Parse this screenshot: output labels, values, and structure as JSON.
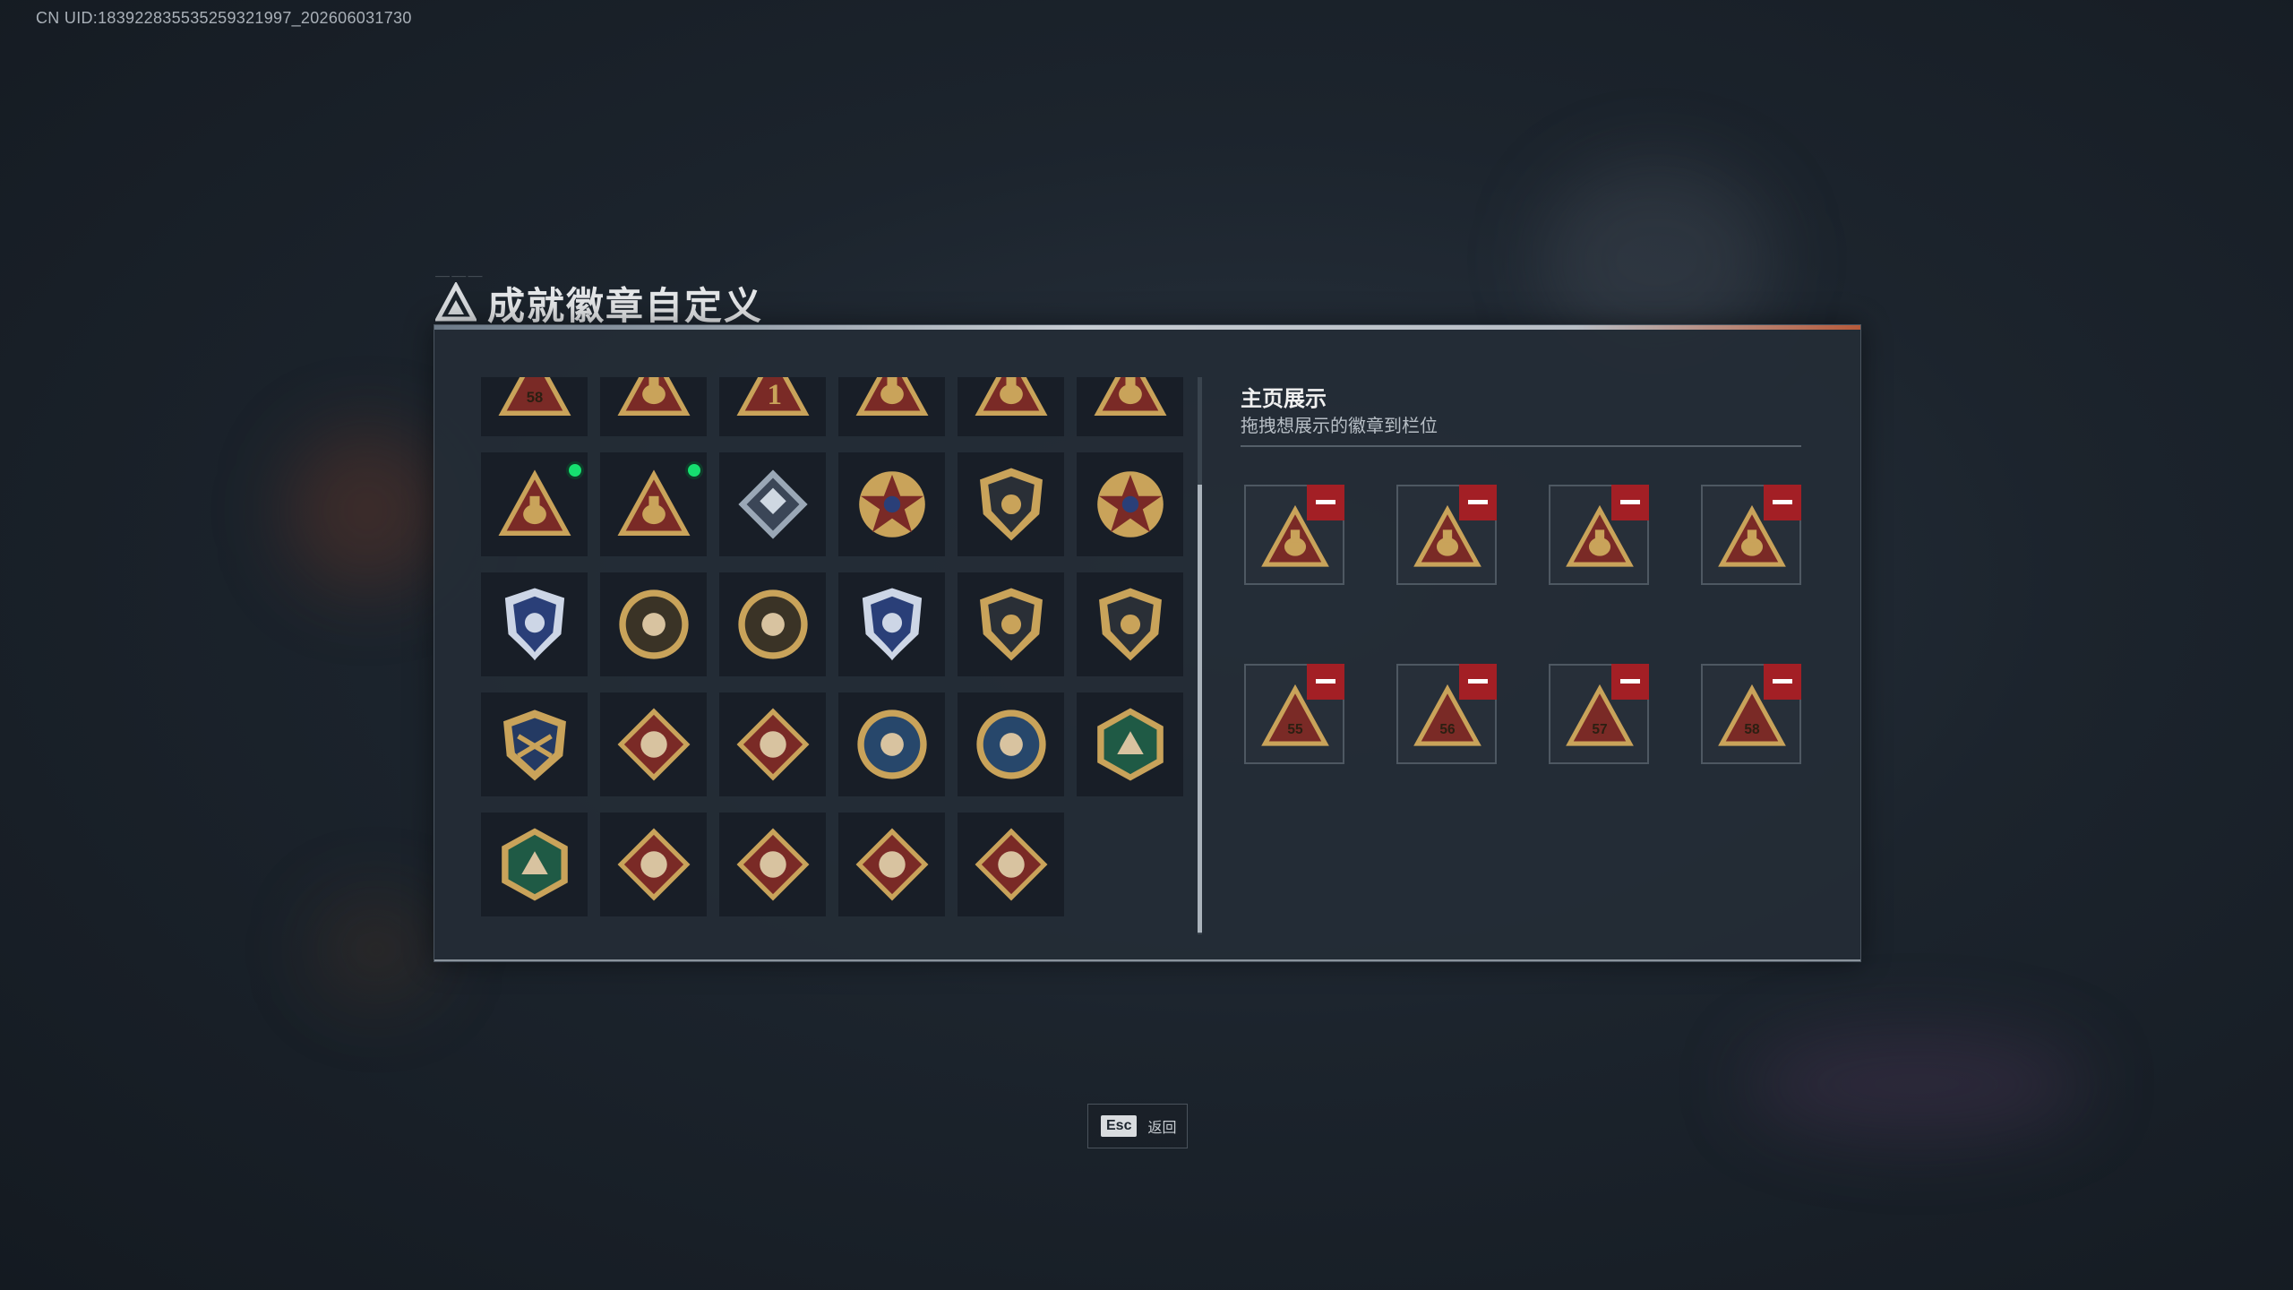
{
  "uid_text": "CN UID:183922835535259321997_202606031730",
  "title": "成就徽章自定义",
  "colors": {
    "accent_gold": "#c9a35a",
    "badge_red": "#7a2a26",
    "badge_dark": "#2a2f36",
    "new_indicator": "#16e070",
    "remove_red": "#a31f25"
  },
  "badge_grid": [
    [
      {
        "icon": "triangle-badge-58-icon"
      },
      {
        "icon": "triangle-badge-egg-icon"
      },
      {
        "icon": "triangle-badge-number-one-icon"
      },
      {
        "icon": "triangle-badge-tower-icon"
      },
      {
        "icon": "triangle-badge-soldier-icon"
      },
      {
        "icon": "triangle-badge-gear-icon"
      }
    ],
    [
      {
        "icon": "triangle-badge-figure-icon",
        "new": true
      },
      {
        "icon": "triangle-badge-rocket-icon",
        "new": true
      },
      {
        "icon": "diamond-crystal-badge-icon"
      },
      {
        "icon": "star-medal-badge-icon"
      },
      {
        "icon": "shield-emblem-badge-icon"
      },
      {
        "icon": "star-shield-medal-icon"
      }
    ],
    [
      {
        "icon": "blue-shield-crest-icon"
      },
      {
        "icon": "round-badge-ring-icon"
      },
      {
        "icon": "round-badge-crosshair-icon"
      },
      {
        "icon": "blue-wreath-crossed-guns-icon"
      },
      {
        "icon": "shield-rifle-badge-icon"
      },
      {
        "icon": "shield-target-badge-icon"
      }
    ],
    [
      {
        "icon": "gold-crest-crossed-arms-icon"
      },
      {
        "icon": "diamond-wolf-badge-icon"
      },
      {
        "icon": "diamond-wolf-badge-alt-icon"
      },
      {
        "icon": "round-eagle-badge-icon"
      },
      {
        "icon": "round-eagle-badge-alt-icon"
      },
      {
        "icon": "hexagon-wasp-badge-icon"
      }
    ],
    [
      {
        "icon": "hexagon-drill-badge-icon"
      },
      {
        "icon": "diamond-dragon-badge-icon"
      },
      {
        "icon": "diamond-runner-badge-icon"
      },
      {
        "icon": "diamond-fist-badge-icon"
      },
      {
        "icon": "diamond-weapon-badge-icon"
      }
    ]
  ],
  "display": {
    "title": "主页展示",
    "subtitle": "拖拽想展示的徽章到栏位",
    "slots": [
      {
        "icon": "triangle-badge-gear-icon"
      },
      {
        "icon": "triangle-badge-soldier-icon"
      },
      {
        "icon": "triangle-badge-rocket-icon"
      },
      {
        "icon": "triangle-badge-figure-icon"
      },
      {
        "icon": "triangle-badge-55-icon"
      },
      {
        "icon": "triangle-badge-56-icon"
      },
      {
        "icon": "triangle-badge-57-icon"
      },
      {
        "icon": "triangle-badge-58-icon"
      }
    ]
  },
  "footer": {
    "key": "Esc",
    "label": "返回"
  }
}
